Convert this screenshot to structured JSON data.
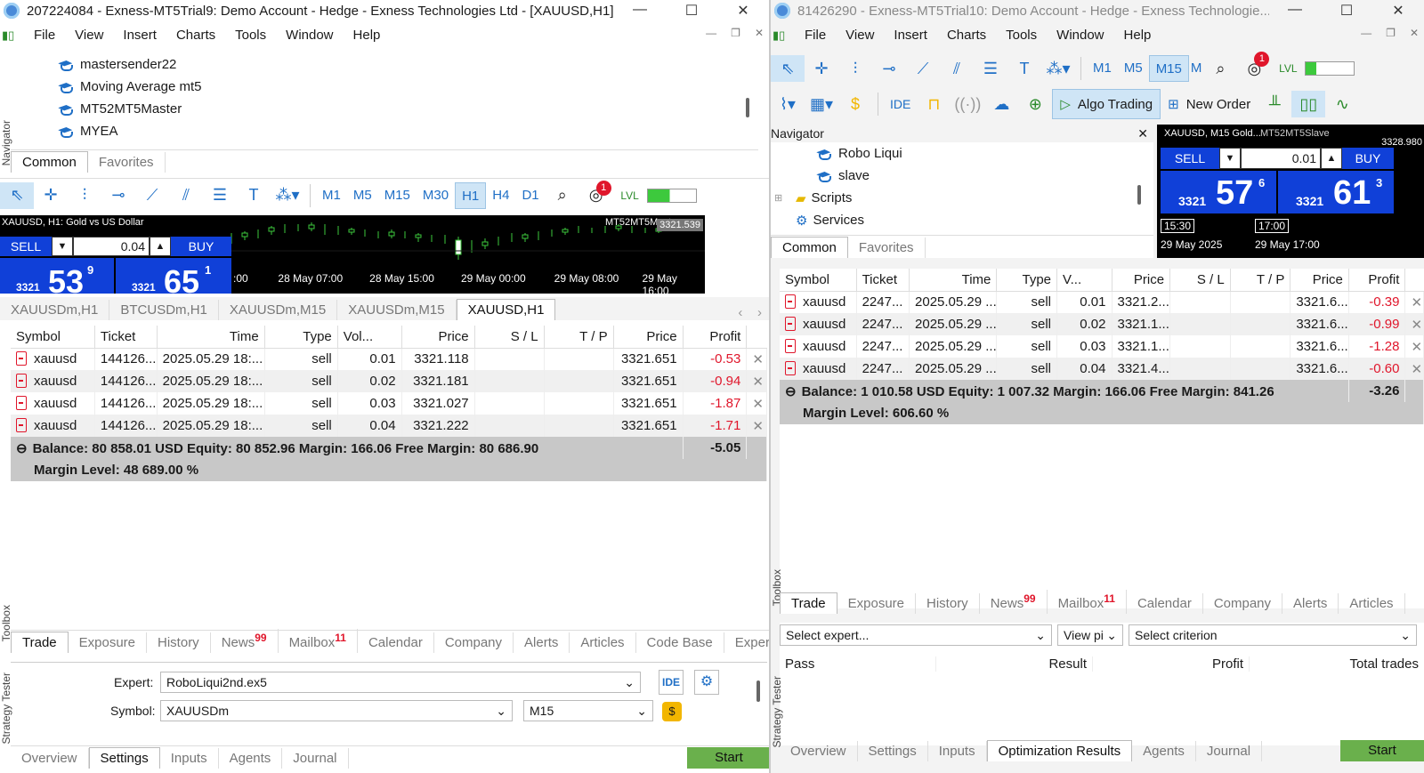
{
  "left": {
    "title": "207224084 - Exness-MT5Trial9: Demo Account - Hedge - Exness Technologies Ltd - [XAUUSD,H1]",
    "menu": [
      "File",
      "View",
      "Insert",
      "Charts",
      "Tools",
      "Window",
      "Help"
    ],
    "navigator_items": [
      "mastersender22",
      "Moving Average mt5",
      "MT52MT5Master",
      "MYEA"
    ],
    "navigator_tabs": [
      "Common",
      "Favorites"
    ],
    "timeframes": [
      "M1",
      "M5",
      "M15",
      "M30",
      "H1",
      "H4",
      "D1"
    ],
    "selected_timeframe": "H1",
    "notification_count": "1",
    "chart": {
      "symbol_label": "XAUUSD, H1:  Gold vs US Dollar",
      "ea_label": "MT52MT5Master",
      "price_tag": "3321.539",
      "sell_label": "SELL",
      "buy_label": "BUY",
      "volume": "0.04",
      "sell_price_small": "3321",
      "sell_price_big": "53",
      "sell_price_sup": "9",
      "buy_price_small": "3321",
      "buy_price_big": "65",
      "buy_price_sup": "1",
      "time_labels": [
        ":00",
        "28 May 07:00",
        "28 May 15:00",
        "29 May 00:00",
        "29 May 08:00",
        "29 May 16:00"
      ]
    },
    "chart_tabs": [
      "XAUUSDm,H1",
      "BTCUSDm,H1",
      "XAUUSDm,M15",
      "XAUUSDm,M15",
      "XAUUSD,H1"
    ],
    "columns": [
      "Symbol",
      "Ticket",
      "Time",
      "Type",
      "Vol...",
      "Price",
      "S / L",
      "T / P",
      "Price",
      "Profit"
    ],
    "rows": [
      [
        "xauusd",
        "144126...",
        "2025.05.29 18:...",
        "sell",
        "0.01",
        "3321.118",
        "",
        "",
        "3321.651",
        "-0.53"
      ],
      [
        "xauusd",
        "144126...",
        "2025.05.29 18:...",
        "sell",
        "0.02",
        "3321.181",
        "",
        "",
        "3321.651",
        "-0.94"
      ],
      [
        "xauusd",
        "144126...",
        "2025.05.29 18:...",
        "sell",
        "0.03",
        "3321.027",
        "",
        "",
        "3321.651",
        "-1.87"
      ],
      [
        "xauusd",
        "144126...",
        "2025.05.29 18:...",
        "sell",
        "0.04",
        "3321.222",
        "",
        "",
        "3321.651",
        "-1.71"
      ]
    ],
    "summary": "Balance: 80 858.01 USD  Equity: 80 852.96  Margin: 166.06  Free Margin: 80 686.90",
    "summary_profit": "-5.05",
    "margin_level": "Margin Level: 48 689.00 %",
    "toolbox_tabs": [
      "Trade",
      "Exposure",
      "History",
      "News",
      "Mailbox",
      "Calendar",
      "Company",
      "Alerts",
      "Articles",
      "Code Base",
      "Exper"
    ],
    "news_count": "99",
    "mail_count": "11",
    "toolbox_label": "Toolbox",
    "navigator_label": "Navigator",
    "tester": {
      "expert_label": "Expert:",
      "expert_value": "RoboLiqui2nd.ex5",
      "symbol_label": "Symbol:",
      "symbol_value": "XAUUSDm",
      "period_value": "M15",
      "ide_label": "IDE",
      "tabs": [
        "Overview",
        "Settings",
        "Inputs",
        "Agents",
        "Journal"
      ],
      "start_label": "Start",
      "side_label": "Strategy Tester"
    }
  },
  "right": {
    "title": "81426290 - Exness-MT5Trial10: Demo Account - Hedge - Exness Technologie...",
    "menu": [
      "File",
      "View",
      "Insert",
      "Charts",
      "Tools",
      "Window",
      "Help"
    ],
    "timeframes": [
      "M1",
      "M5",
      "M15",
      "M"
    ],
    "selected_timeframe": "M15",
    "notification_count": "1",
    "ide_label": "IDE",
    "algo_trading_label": "Algo Trading",
    "new_order_label": "New Order",
    "navigator_title": "Navigator",
    "navigator_items": [
      "Robo Liqui",
      "slave",
      "Scripts",
      "Services"
    ],
    "navigator_tabs": [
      "Common",
      "Favorites"
    ],
    "chart": {
      "symbol_label": "XAUUSD, M15  Gold...",
      "ea_label": "MT52MT5Slave",
      "price_tag": "3328.980",
      "sell_label": "SELL",
      "buy_label": "BUY",
      "volume": "0.01",
      "sell_price_small": "3321",
      "sell_price_big": "57",
      "sell_price_sup": "6",
      "buy_price_small": "3321",
      "buy_price_big": "61",
      "buy_price_sup": "3",
      "time1": "15:30",
      "time2": "17:00",
      "date1": "29 May 2025",
      "date2": "29 May 17:00"
    },
    "columns": [
      "Symbol",
      "Ticket",
      "Time",
      "Type",
      "V...",
      "Price",
      "S / L",
      "T / P",
      "Price",
      "Profit"
    ],
    "rows": [
      [
        "xauusd",
        "2247...",
        "2025.05.29 ...",
        "sell",
        "0.01",
        "3321.2...",
        "",
        "",
        "3321.6...",
        "-0.39"
      ],
      [
        "xauusd",
        "2247...",
        "2025.05.29 ...",
        "sell",
        "0.02",
        "3321.1...",
        "",
        "",
        "3321.6...",
        "-0.99"
      ],
      [
        "xauusd",
        "2247...",
        "2025.05.29 ...",
        "sell",
        "0.03",
        "3321.1...",
        "",
        "",
        "3321.6...",
        "-1.28"
      ],
      [
        "xauusd",
        "2247...",
        "2025.05.29 ...",
        "sell",
        "0.04",
        "3321.4...",
        "",
        "",
        "3321.6...",
        "-0.60"
      ]
    ],
    "summary": "Balance: 1 010.58 USD  Equity: 1 007.32  Margin: 166.06  Free Margin: 841.26",
    "summary_profit": "-3.26",
    "margin_level": "Margin Level: 606.60 %",
    "toolbox_tabs": [
      "Trade",
      "Exposure",
      "History",
      "News",
      "Mailbox",
      "Calendar",
      "Company",
      "Alerts",
      "Articles"
    ],
    "news_count": "99",
    "mail_count": "11",
    "toolbox_label": "Toolbox",
    "tester": {
      "select_expert": "Select expert...",
      "view_label": "View pi",
      "select_criterion": "Select criterion",
      "columns": [
        "Pass",
        "Result",
        "Profit",
        "Total trades"
      ],
      "tabs": [
        "Overview",
        "Settings",
        "Inputs",
        "Optimization Results",
        "Agents",
        "Journal"
      ],
      "start_label": "Start",
      "side_label": "Strategy Tester"
    }
  },
  "colors": {
    "accent": "#1f6fc6",
    "sell": "#1040d8",
    "profit_neg": "#e0162b",
    "start": "#6ab04c",
    "summary_bg": "#c8c8c8"
  }
}
